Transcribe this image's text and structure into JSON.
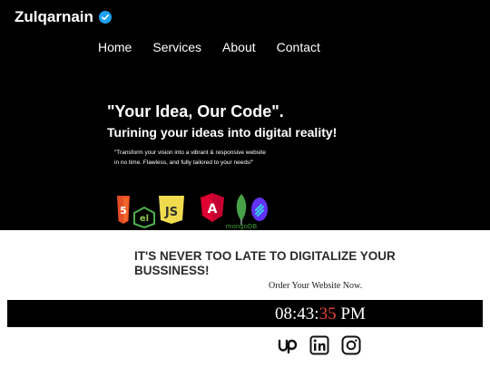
{
  "header": {
    "brand": "Zulqarnain",
    "verified_icon": "verified-badge-icon",
    "accent": "#1da1f2"
  },
  "nav": {
    "items": [
      {
        "label": "Home"
      },
      {
        "label": "Services"
      },
      {
        "label": "About"
      },
      {
        "label": "Contact"
      }
    ]
  },
  "hero": {
    "headline": "\"Your Idea, Our Code\".",
    "subheadline": "Turining your ideas into digital reality!",
    "description": "\"Transform your vision into a vibrant & responsive website in no time. Flawless, and fully tailored to your needs!\"",
    "background": "#000000",
    "tech_logos": [
      {
        "icon": "html5-logo-icon",
        "text": "5"
      },
      {
        "icon": "electron-logo-icon",
        "text": "el"
      },
      {
        "icon": "javascript-logo-icon",
        "text": "JS"
      },
      {
        "icon": "angular-logo-icon",
        "text": "A"
      },
      {
        "icon": "mongodb-logo-icon",
        "text": "mongoDB"
      },
      {
        "icon": "swiper-logo-icon",
        "text": ""
      }
    ]
  },
  "cta": {
    "title": "IT'S NEVER TOO LATE TO DIGITALIZE YOUR BUSSINESS!",
    "link": "Order Your Website Now."
  },
  "clock": {
    "hours": "08",
    "minutes": "43",
    "seconds": "35",
    "period": "PM",
    "seconds_color": "#e8453c"
  },
  "social": [
    {
      "icon": "upwork-icon"
    },
    {
      "icon": "linkedin-icon"
    },
    {
      "icon": "instagram-icon"
    }
  ]
}
